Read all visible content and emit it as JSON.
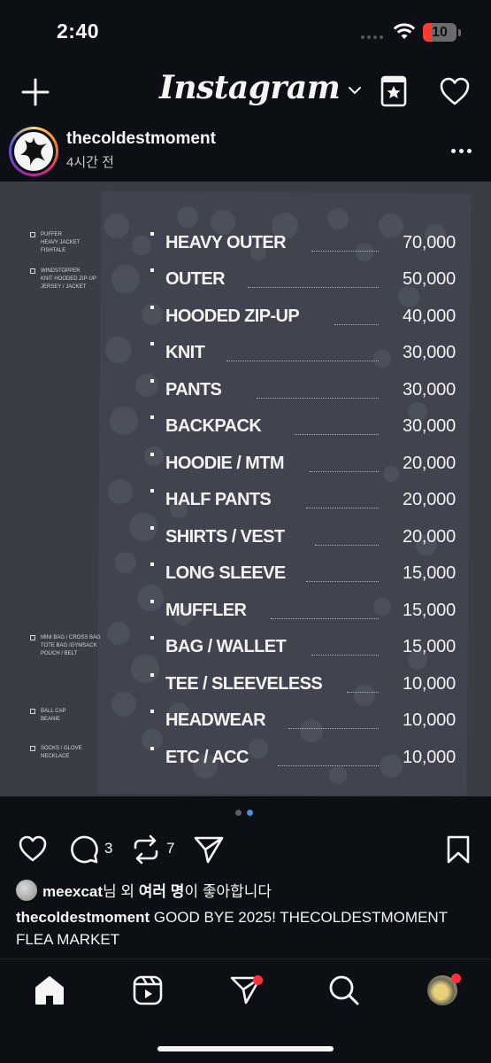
{
  "status_bar": {
    "time": "2:40",
    "battery": "10",
    "battery_color": "#ff3b30"
  },
  "header": {
    "logo": "Instagram",
    "icons": [
      "plus-icon",
      "chevron-down-icon",
      "favorites-icon",
      "heart-icon"
    ]
  },
  "post": {
    "username": "thecoldestmoment",
    "time_ago": "4시간 전",
    "image": {
      "side_notes": [
        {
          "lines": [
            "PUFFER",
            "HEAVY JACKET",
            "FISHTALE"
          ]
        },
        {
          "lines": [
            "WINDSTOPPER",
            "KNIT HOODED ZIP-UP",
            "JERSEY / JACKET"
          ]
        },
        {
          "lines": [
            "MINI BAG / CROSS BAG",
            "TOTE BAG /GYMSACK",
            "POUCH / BELT"
          ]
        },
        {
          "lines": [
            "BALL CAP",
            "BEANIE"
          ]
        },
        {
          "lines": [
            "SOCKS / GLOVE",
            "NECKLACE"
          ]
        }
      ],
      "price_list": [
        {
          "name": "HEAVY OUTER",
          "price": "70,000"
        },
        {
          "name": "OUTER",
          "price": "50,000"
        },
        {
          "name": "HOODED ZIP-UP",
          "price": "40,000"
        },
        {
          "name": "KNIT",
          "price": "30,000"
        },
        {
          "name": "PANTS",
          "price": "30,000"
        },
        {
          "name": "BACKPACK",
          "price": "30,000"
        },
        {
          "name": "HOODIE / MTM",
          "price": "20,000"
        },
        {
          "name": "HALF PANTS",
          "price": "20,000"
        },
        {
          "name": "SHIRTS / VEST",
          "price": "20,000"
        },
        {
          "name": "LONG SLEEVE",
          "price": "15,000"
        },
        {
          "name": "MUFFLER",
          "price": "15,000"
        },
        {
          "name": "BAG / WALLET",
          "price": "15,000"
        },
        {
          "name": "TEE / SLEEVELESS",
          "price": "10,000"
        },
        {
          "name": "HEADWEAR",
          "price": "10,000"
        },
        {
          "name": "ETC / ACC",
          "price": "10,000"
        }
      ]
    },
    "carousel": {
      "total": 2,
      "active": 2,
      "active_color": "#4a90e2"
    },
    "actions": {
      "comments": "3",
      "reposts": "7"
    },
    "likes": {
      "user": "meexcat",
      "text_mid": "님 외 ",
      "text_bold": "여러 명",
      "text_end": "이 좋아합니다"
    },
    "caption": {
      "user": "thecoldestmoment",
      "text": " GOOD BYE 2025! THECOLDESTMOMENT FLEA MARKET"
    }
  },
  "bottom_nav": [
    "home-icon",
    "reels-icon",
    "send-icon",
    "search-icon",
    "profile-avatar"
  ],
  "colors": {
    "background": "#0c1014",
    "notification": "#ff3040"
  }
}
